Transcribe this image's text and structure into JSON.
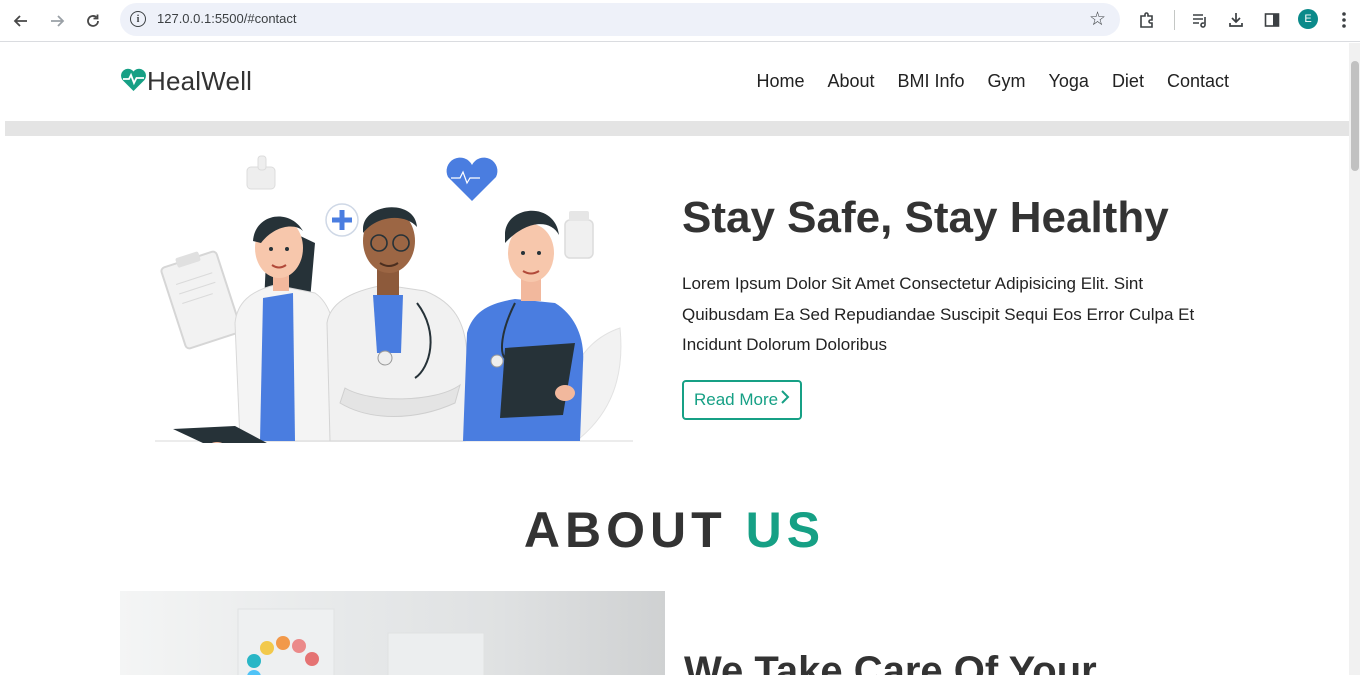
{
  "browser": {
    "url": "127.0.0.1:5500/#contact",
    "profile_initial": "E",
    "icons": [
      "back-icon",
      "forward-icon",
      "reload-icon",
      "site-info-icon",
      "bookmark-star-icon",
      "extensions-icon",
      "reading-list-icon",
      "download-icon",
      "side-panel-icon",
      "menu-kebab-icon"
    ]
  },
  "site": {
    "logo": "HealWell",
    "nav": [
      "Home",
      "About",
      "BMI Info",
      "Gym",
      "Yoga",
      "Diet",
      "Contact"
    ]
  },
  "hero": {
    "title": "Stay Safe, Stay Healthy",
    "text": "Lorem Ipsum Dolor Sit Amet Consectetur Adipisicing Elit. Sint Quibusdam Ea Sed Repudiandae Suscipit Sequi Eos Error Culpa Et Incidunt Dolorum Doloribus",
    "button": "Read More"
  },
  "about": {
    "heading_main": "ABOUT",
    "heading_accent": "US",
    "subheading": "We Take Care Of Your"
  },
  "colors": {
    "accent": "#16a085",
    "doctor_blue": "#4a7de0",
    "text_dark": "#333333"
  }
}
